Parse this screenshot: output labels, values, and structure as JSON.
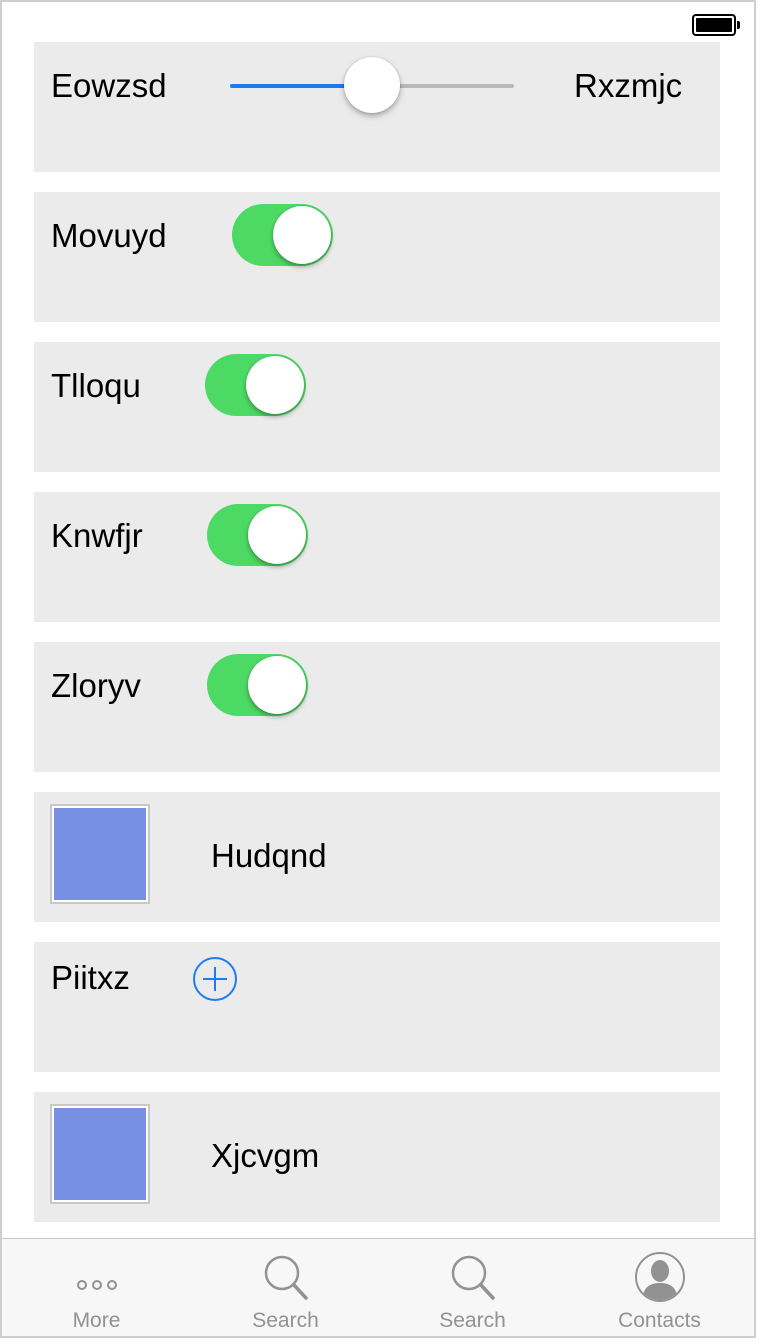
{
  "status_bar": {
    "battery_icon": "battery-full-icon"
  },
  "rows": {
    "slider": {
      "label_left": "Eowzsd",
      "label_right": "Rxzmjc",
      "value": 0.5,
      "min_color": "#1c7cf0",
      "max_color": "#b9b9b9"
    },
    "toggle1": {
      "label": "Movuyd",
      "on": true
    },
    "toggle2": {
      "label": "Tlloqu",
      "on": true
    },
    "toggle3": {
      "label": "Knwfjr",
      "on": true
    },
    "toggle4": {
      "label": "Zloryv",
      "on": true
    },
    "image1": {
      "label": "Hudqnd",
      "color": "#7890e3"
    },
    "add": {
      "label": "Piitxz",
      "icon": "add-circle-icon",
      "color": "#1c7cf0"
    },
    "image2": {
      "label": "Xjcvgm",
      "color": "#7890e3"
    }
  },
  "toggle_on_color": "#4cd964",
  "tabbar": {
    "tabs": [
      {
        "label": "More",
        "icon": "more-icon"
      },
      {
        "label": "Search",
        "icon": "search-icon"
      },
      {
        "label": "Search",
        "icon": "search-icon"
      },
      {
        "label": "Contacts",
        "icon": "contacts-icon"
      }
    ]
  }
}
